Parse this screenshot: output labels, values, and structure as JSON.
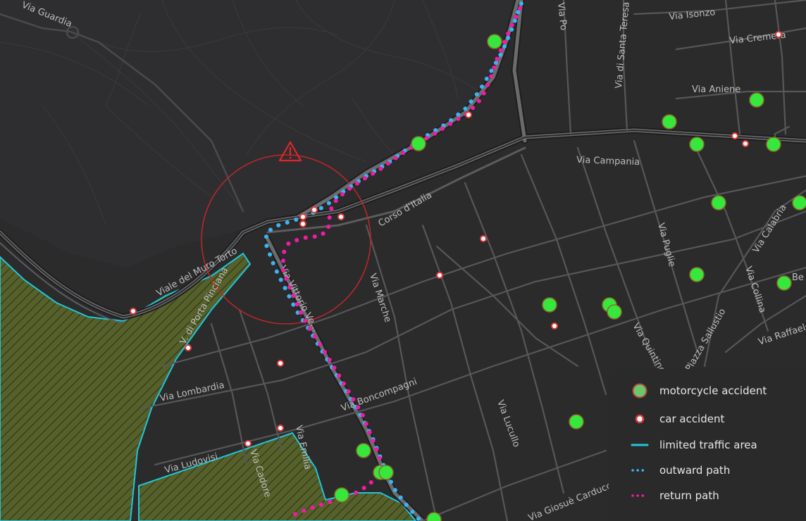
{
  "colors": {
    "background": "#2b2b2c",
    "park": "#2f2f30",
    "limited_traffic_fill": "#55602a",
    "limited_traffic_border": "#1fc6da",
    "outward": "#3ab4f2",
    "return": "#f21ba5",
    "motorcycle": "#37e83c",
    "car": "#e23a3a",
    "warning": "#e0262a"
  },
  "streets": [
    {
      "id": "via-guardia",
      "text": "Via Guardia"
    },
    {
      "id": "via-po",
      "text": "Via Po"
    },
    {
      "id": "via-santa-teresa",
      "text": "Via di Santa Teresa"
    },
    {
      "id": "via-isonzo",
      "text": "Via Isonzo"
    },
    {
      "id": "via-cremera",
      "text": "Via Cremera"
    },
    {
      "id": "via-aniene",
      "text": "Via Aniene"
    },
    {
      "id": "via-campania",
      "text": "Via Campania"
    },
    {
      "id": "corso-italia",
      "text": "Corso d'Italia"
    },
    {
      "id": "viale-muro-torto",
      "text": "Viale del Muro Torto"
    },
    {
      "id": "via-porta-pinciana",
      "text": "V. di Porta Pinciana"
    },
    {
      "id": "via-vittorio-veneto",
      "text": "Via Vittorio Ve..."
    },
    {
      "id": "via-marche",
      "text": "Via Marche"
    },
    {
      "id": "via-puglie",
      "text": "Via Puglie"
    },
    {
      "id": "via-calabria",
      "text": "Via Calabria"
    },
    {
      "id": "via-collina",
      "text": "Via Collina"
    },
    {
      "id": "via-raffaele",
      "text": "Via Raffaele"
    },
    {
      "id": "via-quintino",
      "text": "Via Quintino"
    },
    {
      "id": "piazza-sallustio",
      "text": "Piazza Sallustio"
    },
    {
      "id": "via-lombardia",
      "text": "Via Lombardia"
    },
    {
      "id": "via-boncompagni",
      "text": "Via Boncompagni"
    },
    {
      "id": "via-lucullo",
      "text": "Via Lucullo"
    },
    {
      "id": "via-ludovisi",
      "text": "Via Ludovisi"
    },
    {
      "id": "via-emilia",
      "text": "Via Emilia"
    },
    {
      "id": "via-cadore",
      "text": "Via Cadore"
    },
    {
      "id": "via-giosue-carducci",
      "text": "Via Giosuè Carducci"
    },
    {
      "id": "via-be",
      "text": "Be"
    }
  ],
  "legend": {
    "items": [
      {
        "icon": "motorcycle-accident-icon",
        "label": "motorcycle accident"
      },
      {
        "icon": "car-accident-icon",
        "label": "car accident"
      },
      {
        "icon": "limited-traffic-line-icon",
        "label": "limited traffic area"
      },
      {
        "icon": "outward-path-icon",
        "label": "outward path"
      },
      {
        "icon": "return-path-icon",
        "label": "return path"
      }
    ]
  },
  "hotspot": {
    "icon": "warning-triangle-icon"
  }
}
